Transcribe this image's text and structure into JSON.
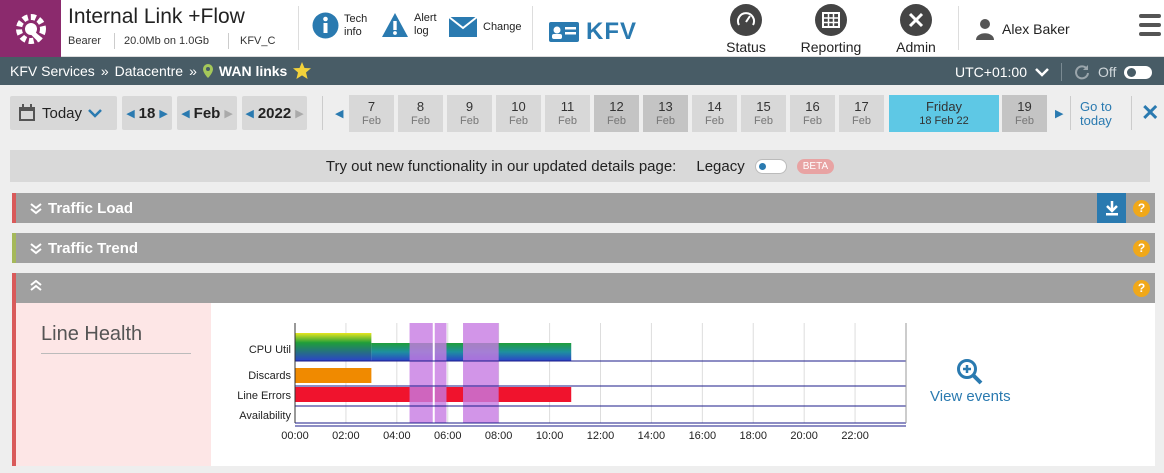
{
  "header": {
    "title": "Internal Link +Flow",
    "meta": [
      "Bearer",
      "20.0Mb on 1.0Gb",
      "KFV_C"
    ],
    "quick_actions": [
      {
        "icon": "info-icon",
        "label": "Tech\ninfo"
      },
      {
        "icon": "alert-icon",
        "label": "Alert\nlog"
      },
      {
        "icon": "envelope-icon",
        "label": "Change"
      }
    ],
    "brand": "KFV",
    "nav": [
      {
        "icon": "speedometer-icon",
        "label": "Status"
      },
      {
        "icon": "calendar-grid-icon",
        "label": "Reporting"
      },
      {
        "icon": "tools-icon",
        "label": "Admin"
      }
    ],
    "user": "Alex Baker"
  },
  "breadcrumb": {
    "items": [
      "KFV Services",
      "Datacentre",
      "WAN links"
    ],
    "separator": "»",
    "timezone": "UTC+01:00",
    "refresh_state": "Off"
  },
  "datebar": {
    "today_label": "Today",
    "day": "18",
    "month": "Feb",
    "year": "2022",
    "days": [
      {
        "num": "7",
        "mon": "Feb"
      },
      {
        "num": "8",
        "mon": "Feb"
      },
      {
        "num": "9",
        "mon": "Feb"
      },
      {
        "num": "10",
        "mon": "Feb"
      },
      {
        "num": "11",
        "mon": "Feb"
      },
      {
        "num": "12",
        "mon": "Feb"
      },
      {
        "num": "13",
        "mon": "Feb"
      },
      {
        "num": "14",
        "mon": "Feb"
      },
      {
        "num": "15",
        "mon": "Feb"
      },
      {
        "num": "16",
        "mon": "Feb"
      },
      {
        "num": "17",
        "mon": "Feb"
      },
      {
        "num": "Friday",
        "mon": "18 Feb 22"
      },
      {
        "num": "19",
        "mon": "Feb"
      }
    ],
    "goto_label": "Go to\ntoday"
  },
  "notice": {
    "text": "Try out new functionality in our updated details page:",
    "legacy_label": "Legacy",
    "beta_label": "BETA"
  },
  "panels": {
    "traffic_load": "Traffic Load",
    "traffic_trend": "Traffic Trend"
  },
  "line_health": {
    "title": "Line Health",
    "view_events": "View events",
    "colors": {
      "cpu_low": "#1f9e3a",
      "cpu_high": "#2b43c9",
      "discards": "#f08a00",
      "errors": "#f0132d",
      "window": "#c77be2",
      "axis": "#1b1b8a"
    }
  },
  "chart_data": {
    "type": "heatmap",
    "rows": [
      "CPU Util",
      "Discards",
      "Line Errors",
      "Availability"
    ],
    "x_ticks": [
      "00:00",
      "02:00",
      "04:00",
      "06:00",
      "08:00",
      "10:00",
      "12:00",
      "14:00",
      "16:00",
      "18:00",
      "20:00",
      "22:00"
    ],
    "xlim_hours": [
      0,
      24
    ],
    "data_end_hour": 10.85,
    "cpu_util": [
      {
        "from_hour": 0,
        "to_hour": 3.0,
        "level": "high"
      },
      {
        "from_hour": 3.0,
        "to_hour": 10.85,
        "level": "low"
      }
    ],
    "discards": [
      {
        "from_hour": 0,
        "to_hour": 3.0
      }
    ],
    "line_errors": [
      {
        "from_hour": 0,
        "to_hour": 10.85
      }
    ],
    "maintenance_windows": [
      {
        "from_hour": 4.5,
        "to_hour": 5.95
      },
      {
        "from_hour": 6.6,
        "to_hour": 8.0
      }
    ],
    "marker_hour": 5.45
  }
}
